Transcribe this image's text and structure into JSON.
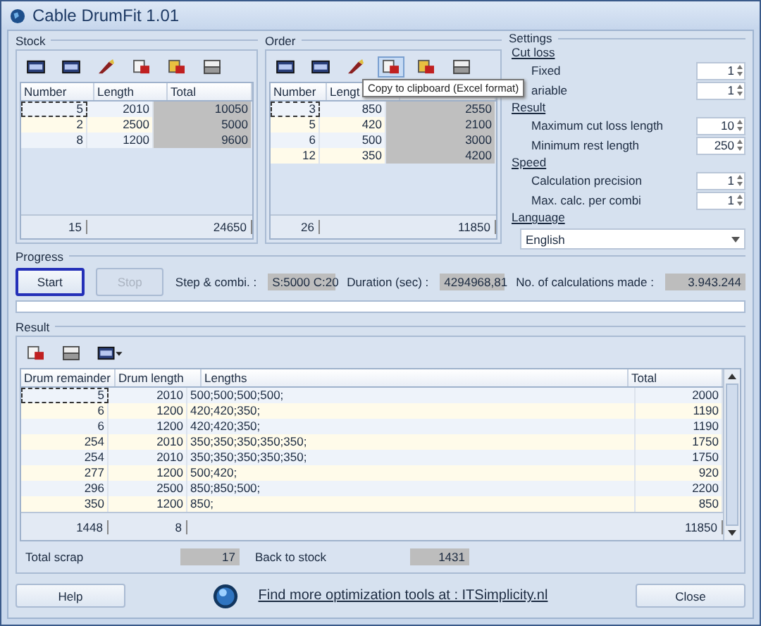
{
  "window": {
    "title": "Cable DrumFit 1.01"
  },
  "stock": {
    "title": "Stock",
    "columns": [
      "Number",
      "Length",
      "Total"
    ],
    "rows": [
      {
        "cells": [
          "5",
          "2010",
          "10050"
        ],
        "selected": true
      },
      {
        "cells": [
          "2",
          "2500",
          "5000"
        ],
        "selected": false
      },
      {
        "cells": [
          "8",
          "1200",
          "9600"
        ],
        "selected": false
      }
    ],
    "footer": [
      "15",
      "24650"
    ]
  },
  "order": {
    "title": "Order",
    "columns": [
      "Number",
      "Lengt"
    ],
    "rows": [
      {
        "cells": [
          "3",
          "850",
          "2550"
        ],
        "selected": true
      },
      {
        "cells": [
          "5",
          "420",
          "2100"
        ],
        "selected": false
      },
      {
        "cells": [
          "6",
          "500",
          "3000"
        ],
        "selected": false
      },
      {
        "cells": [
          "12",
          "350",
          "4200"
        ],
        "selected": false
      }
    ],
    "footer": [
      "26",
      "11850"
    ],
    "tooltip": "Copy to clipboard (Excel format)"
  },
  "settings": {
    "title": "Settings",
    "groups": [
      {
        "heading": "Cut loss",
        "items": [
          {
            "label": "Fixed",
            "value": "1"
          },
          {
            "label": "ariable",
            "value": "1"
          }
        ]
      },
      {
        "heading": "Result",
        "items": [
          {
            "label": "Maximum cut loss length",
            "value": "10"
          },
          {
            "label": "Minimum rest length",
            "value": "250"
          }
        ]
      },
      {
        "heading": "Speed",
        "items": [
          {
            "label": "Calculation precision",
            "value": "1"
          },
          {
            "label": "Max. calc. per combi",
            "value": "1"
          }
        ]
      }
    ],
    "language": {
      "heading": "Language",
      "value": "English"
    }
  },
  "progress": {
    "title": "Progress",
    "buttons": [
      {
        "label": "Start",
        "focused": true,
        "disabled": false
      },
      {
        "label": "Stop",
        "focused": false,
        "disabled": true
      }
    ],
    "readouts": [
      {
        "label": "Step & combi. :",
        "value": "S:5000 C:20"
      },
      {
        "label": "Duration (sec) :",
        "value": "4294968,81"
      },
      {
        "label": "No. of calculations made :",
        "value": "3.943.244"
      }
    ],
    "level": 0
  },
  "result": {
    "title": "Result",
    "columns": [
      "Drum remainder",
      "Drum length",
      "Lengths",
      "Total"
    ],
    "rows": [
      {
        "cells": [
          "5",
          "2010",
          "500;500;500;500;",
          "2000"
        ],
        "selected": true
      },
      {
        "cells": [
          "6",
          "1200",
          "420;420;350;",
          "1190"
        ],
        "selected": false
      },
      {
        "cells": [
          "6",
          "1200",
          "420;420;350;",
          "1190"
        ],
        "selected": false
      },
      {
        "cells": [
          "254",
          "2010",
          "350;350;350;350;350;",
          "1750"
        ],
        "selected": false
      },
      {
        "cells": [
          "254",
          "2010",
          "350;350;350;350;350;",
          "1750"
        ],
        "selected": false
      },
      {
        "cells": [
          "277",
          "1200",
          "500;420;",
          "920"
        ],
        "selected": false
      },
      {
        "cells": [
          "296",
          "2500",
          "850;850;500;",
          "2200"
        ],
        "selected": false
      },
      {
        "cells": [
          "350",
          "1200",
          "850;",
          "850"
        ],
        "selected": false
      }
    ],
    "footer": [
      "1448",
      "8",
      "11850"
    ],
    "totals": [
      {
        "label": "Total scrap",
        "value": "17"
      },
      {
        "label": "Back to stock",
        "value": "1431"
      }
    ]
  },
  "footer": {
    "help": "Help",
    "link": "Find more optimization tools at : ITSimplicity.nl",
    "close": "Close"
  }
}
